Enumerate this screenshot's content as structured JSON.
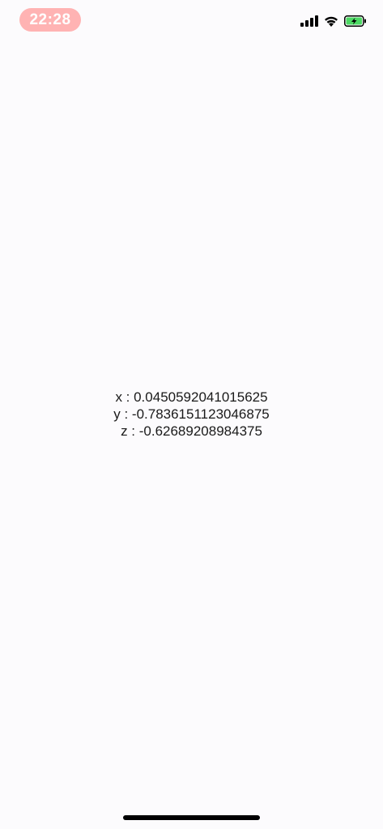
{
  "status_bar": {
    "time": "22:28",
    "time_pill_color": "#ffb3b3",
    "icons": [
      "cellular-signal-icon",
      "wifi-icon",
      "battery-charging-icon"
    ],
    "battery_color": "#4cd964"
  },
  "readout": {
    "x_line": "x : 0.0450592041015625",
    "y_line": "y : -0.7836151123046875",
    "z_line": "z : -0.62689208984375"
  }
}
